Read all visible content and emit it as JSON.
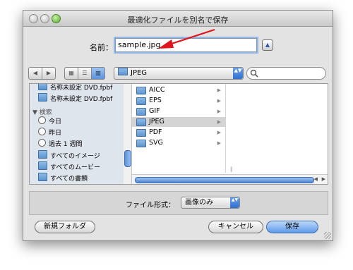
{
  "window": {
    "title": "最適化ファイルを別名で保存"
  },
  "save": {
    "name_label": "名前：",
    "filename": "sample.jpg",
    "expand_glyph": "▲"
  },
  "toolbar": {
    "back_glyph": "◀",
    "forward_glyph": "▶",
    "view_icon_glyph": "▦",
    "view_list_glyph": "☰",
    "view_column_glyph": "▥",
    "location": "JPEG",
    "location_stepper": "▲▼",
    "search_placeholder": ""
  },
  "sidebar": {
    "items_top": [
      {
        "label": "名称未設定 DVD.fpbf",
        "icon": "document-icon"
      },
      {
        "label": "名称未設定 DVD.fpbf",
        "icon": "document-icon"
      }
    ],
    "search_header": "▼ 検索",
    "search_items": [
      {
        "label": "今日",
        "icon": "clock-icon"
      },
      {
        "label": "昨日",
        "icon": "clock-icon"
      },
      {
        "label": "過去 1 週間",
        "icon": "clock-icon"
      },
      {
        "label": "すべてのイメージ",
        "icon": "folder-icon"
      },
      {
        "label": "すべてのムービー",
        "icon": "folder-icon"
      },
      {
        "label": "すべての書類",
        "icon": "folder-icon"
      }
    ]
  },
  "columns": {
    "first": [
      {
        "label": "AICC"
      },
      {
        "label": "EPS"
      },
      {
        "label": "GIF"
      },
      {
        "label": "JPEG",
        "selected": true
      },
      {
        "label": "PDF"
      },
      {
        "label": "SVG"
      }
    ],
    "arrow_glyph": "▶"
  },
  "format": {
    "label": "ファイル形式：",
    "value": "画像のみ",
    "stepper": "▲▼"
  },
  "buttons": {
    "new_folder": "新規フォルダ",
    "cancel": "キャンセル",
    "save": "保存"
  },
  "colors": {
    "annotation_arrow": "#e0161e",
    "selection_blue": "#4f86d4"
  }
}
